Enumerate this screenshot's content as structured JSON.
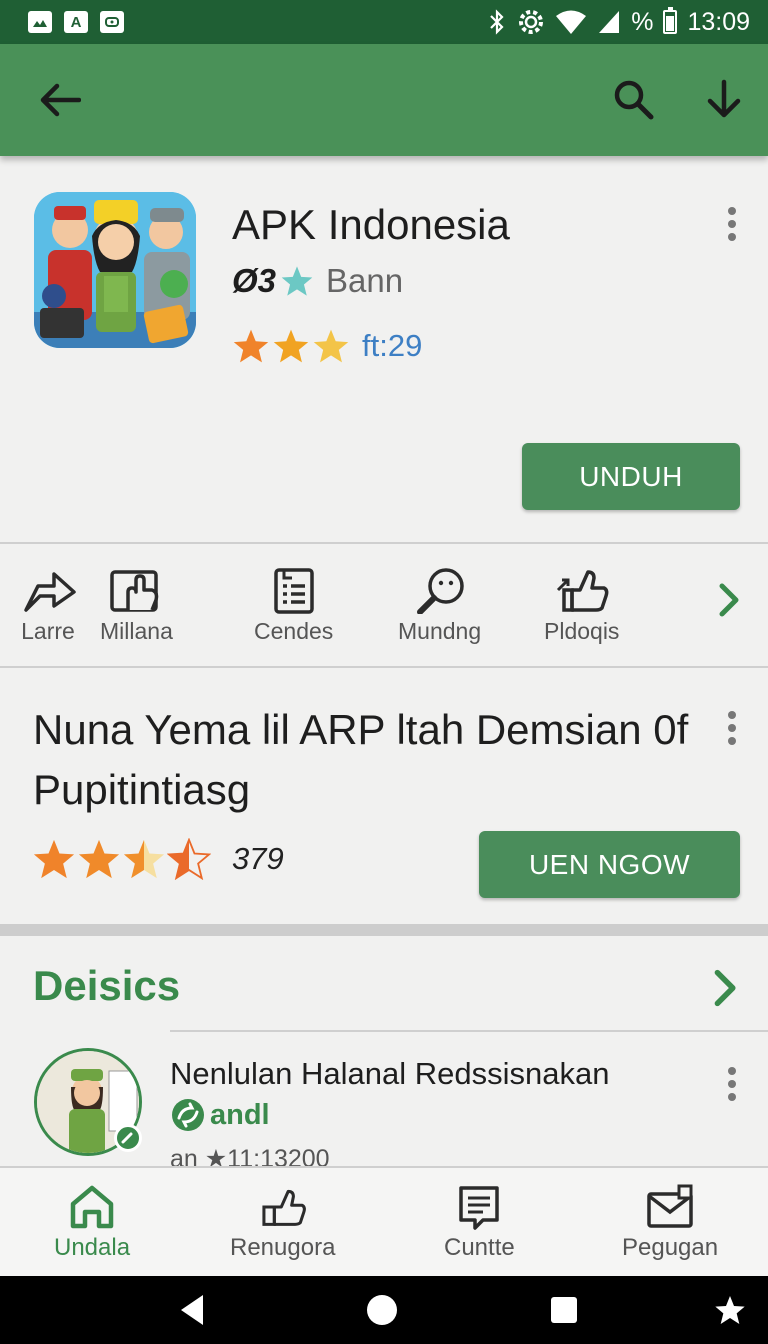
{
  "status_bar": {
    "notifications": [
      "image-icon",
      "A",
      "cast-icon"
    ],
    "time": "13:09",
    "battery_text": "%",
    "battery_level": 0.75
  },
  "toolbar": {
    "back_icon": "arrow-left-icon",
    "search_icon": "search-icon",
    "download_icon": "download-icon"
  },
  "app": {
    "name": "APK Indonesia",
    "rank_number": "Ø3",
    "developer": "Bann",
    "rating_stars": 3,
    "rating_count": "ft:29",
    "install_label": "UNDUH"
  },
  "actions": [
    {
      "label": "Larre",
      "icon": "share-arrow-icon"
    },
    {
      "label": "Millana",
      "icon": "photo-hand-icon"
    },
    {
      "label": "Cendes",
      "icon": "list-document-icon"
    },
    {
      "label": "Mundng",
      "icon": "magnifier-face-icon"
    },
    {
      "label": "Pldoqis",
      "icon": "thumbs-up-icon"
    }
  ],
  "featured": {
    "title": "Nuna Yema lil ARP ltah Demsian 0f Pupitintiasg",
    "rating_stars": 3.5,
    "rating_count": "379",
    "button_label": "UEN NGOW"
  },
  "section": {
    "title": "Deisics"
  },
  "list_item": {
    "title": "Nenlulan Halanal Redssisnakan",
    "developer": "andl",
    "meta": "an ★11:13200"
  },
  "bottom_nav": [
    {
      "label": "Undala",
      "icon": "home-icon",
      "active": true
    },
    {
      "label": "Renugora",
      "icon": "thumbs-up-icon",
      "active": false
    },
    {
      "label": "Cuntte",
      "icon": "document-icon",
      "active": false
    },
    {
      "label": "Pegugan",
      "icon": "mail-icon",
      "active": false
    }
  ],
  "colors": {
    "status_bar": "#1f5f34",
    "toolbar": "#4a9158",
    "accent": "#3a8a4c",
    "button": "#4a8d5b",
    "link": "#3d7fc4"
  }
}
